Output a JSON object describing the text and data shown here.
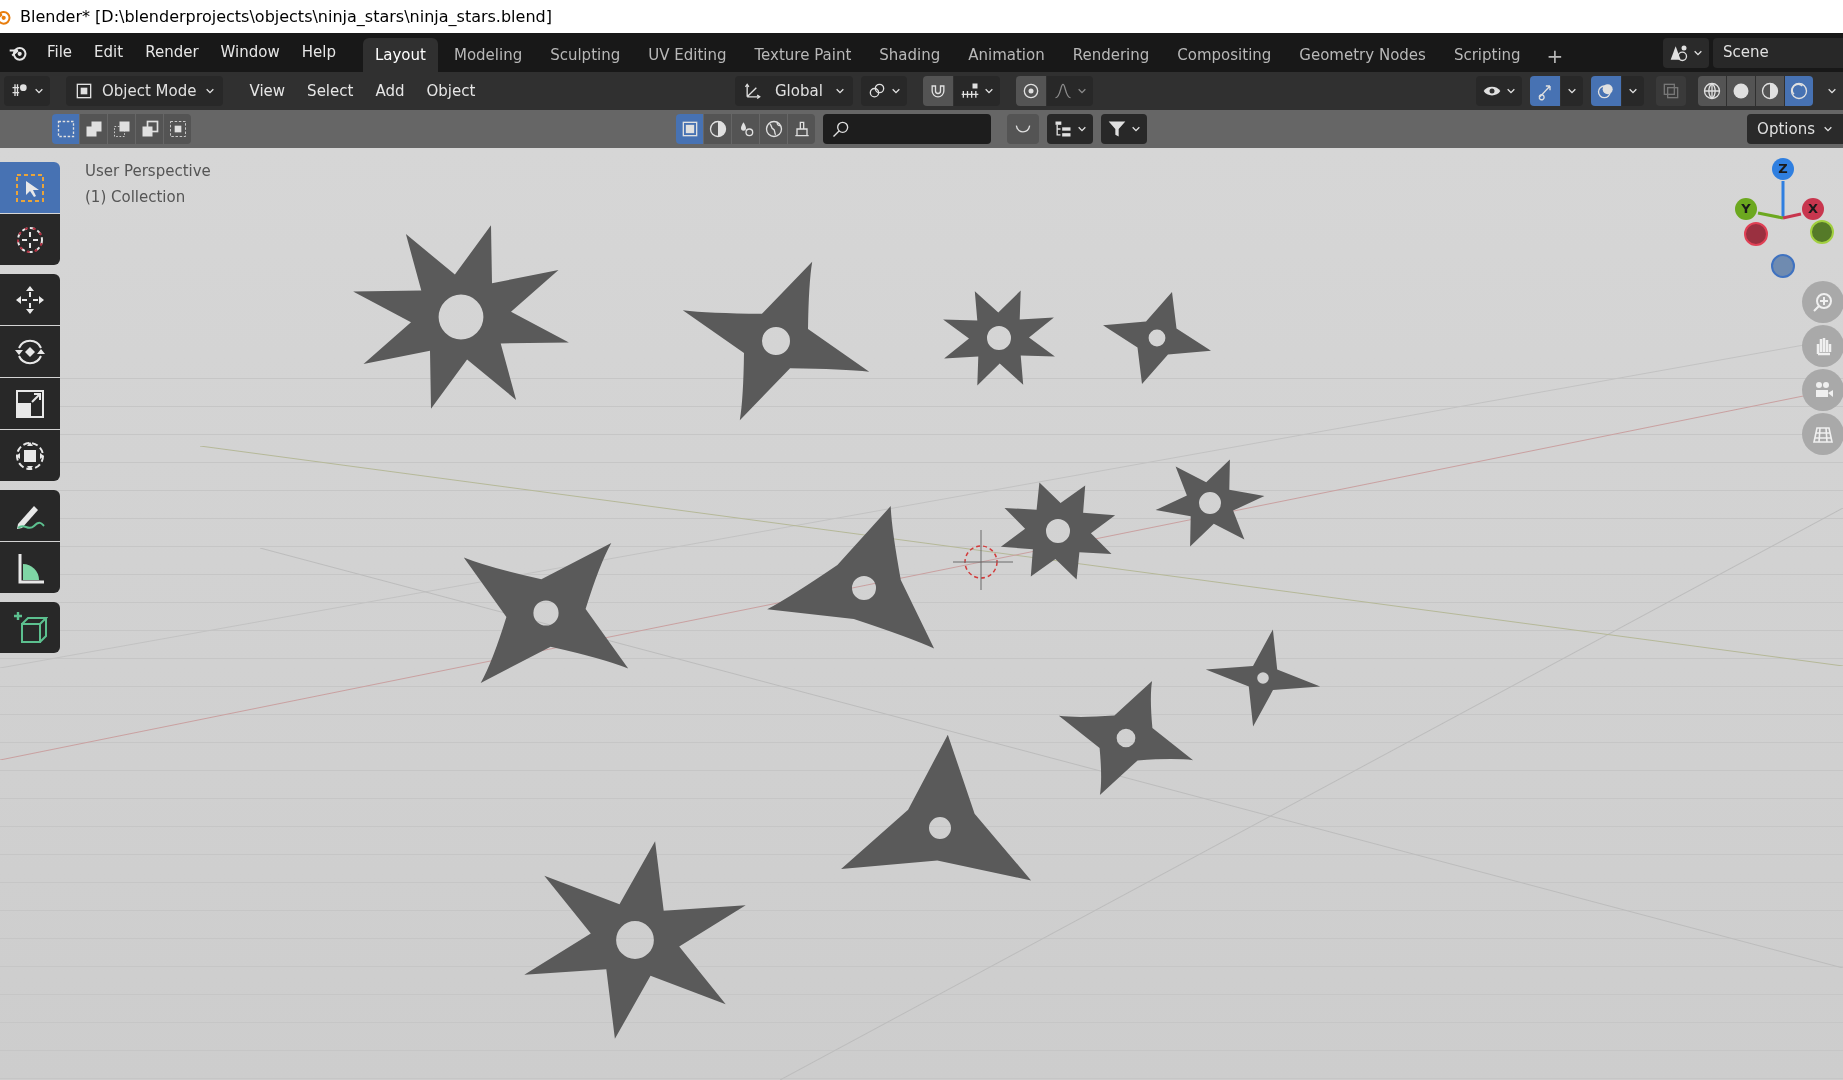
{
  "window": {
    "title": "Blender* [D:\\blenderprojects\\objects\\ninja_stars\\ninja_stars.blend]"
  },
  "menu": [
    "File",
    "Edit",
    "Render",
    "Window",
    "Help"
  ],
  "workspaces": [
    {
      "label": "Layout",
      "selected": true
    },
    {
      "label": "Modeling",
      "selected": false
    },
    {
      "label": "Sculpting",
      "selected": false
    },
    {
      "label": "UV Editing",
      "selected": false
    },
    {
      "label": "Texture Paint",
      "selected": false
    },
    {
      "label": "Shading",
      "selected": false
    },
    {
      "label": "Animation",
      "selected": false
    },
    {
      "label": "Rendering",
      "selected": false
    },
    {
      "label": "Compositing",
      "selected": false
    },
    {
      "label": "Geometry Nodes",
      "selected": false
    },
    {
      "label": "Scripting",
      "selected": false
    }
  ],
  "add_workspace": "+",
  "scene": "Scene",
  "header": {
    "mode": "Object Mode",
    "menus": [
      "View",
      "Select",
      "Add",
      "Object"
    ],
    "orientation": "Global",
    "snap_on": false,
    "proportional_on": false,
    "gizmos_on": true,
    "overlays_on": true,
    "xray_on": false,
    "shading": [
      {
        "kind": "wireframe",
        "selected": false
      },
      {
        "kind": "solid",
        "selected": false
      },
      {
        "kind": "material",
        "selected": false
      },
      {
        "kind": "rendered",
        "selected": true
      }
    ]
  },
  "tool_header": {
    "select_modes": [
      {
        "kind": "set",
        "selected": true
      },
      {
        "kind": "extend",
        "selected": false
      },
      {
        "kind": "subtract",
        "selected": false
      },
      {
        "kind": "invert",
        "selected": false
      },
      {
        "kind": "intersect",
        "selected": false
      }
    ],
    "object_filters": [
      {
        "kind": "object",
        "selected": true
      },
      {
        "kind": "shading",
        "selected": false
      },
      {
        "kind": "particles",
        "selected": false
      },
      {
        "kind": "world",
        "selected": false
      },
      {
        "kind": "brush",
        "selected": false
      }
    ],
    "options": "Options"
  },
  "toolbar": [
    {
      "tools": [
        {
          "kind": "select",
          "selected": true
        },
        {
          "kind": "cursor",
          "selected": false
        }
      ]
    },
    {
      "tools": [
        {
          "kind": "move",
          "selected": false
        },
        {
          "kind": "rotate",
          "selected": false
        },
        {
          "kind": "scale",
          "selected": false
        },
        {
          "kind": "transform",
          "selected": false
        }
      ]
    },
    {
      "tools": [
        {
          "kind": "annotate",
          "selected": false
        },
        {
          "kind": "measure",
          "selected": false
        }
      ]
    },
    {
      "tools": [
        {
          "kind": "add_cube",
          "selected": false
        }
      ]
    }
  ],
  "viewport": {
    "view": "User Perspective",
    "collection": "(1) Collection",
    "axes": [
      {
        "label": "Z",
        "color": "#2f7fe0"
      },
      {
        "label": "Y",
        "color": "#6ca81f"
      },
      {
        "label": "X",
        "color": "#c8364e"
      }
    ]
  }
}
